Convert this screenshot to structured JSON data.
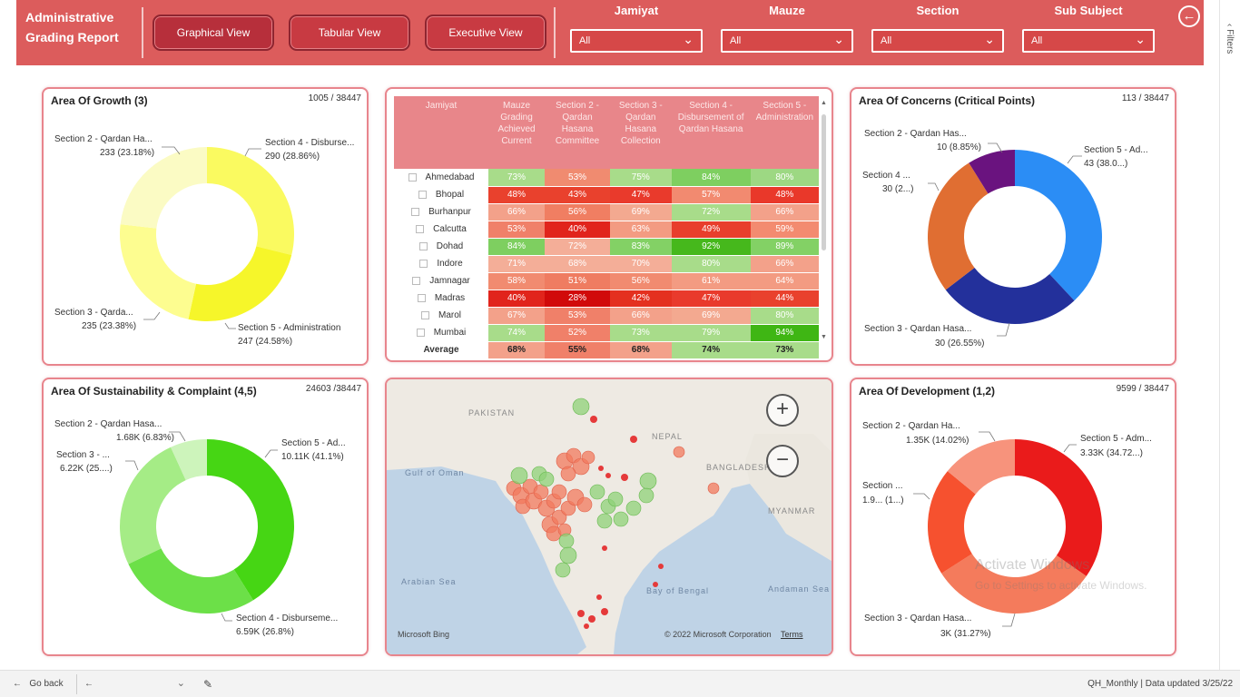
{
  "header": {
    "title_line1": "Administrative",
    "title_line2": "Grading Report",
    "buttons": [
      "Graphical View",
      "Tabular View",
      "Executive View"
    ],
    "slicers": [
      {
        "label": "Jamiyat",
        "value": "All"
      },
      {
        "label": "Mauze",
        "value": "All"
      },
      {
        "label": "Section",
        "value": "All"
      },
      {
        "label": "Sub Subject",
        "value": "All"
      }
    ],
    "back_icon": "back-arrow-icon"
  },
  "filters_pane": {
    "label": "Filters",
    "icon": "chevron-left-icon"
  },
  "panels": {
    "growth": {
      "title": "Area Of Growth (3)",
      "count": "1005 / 38447",
      "labels": [
        {
          "name": "Section 2 - Qardan Ha...",
          "value": "233 (23.18%)"
        },
        {
          "name": "Section 4 - Disburse...",
          "value": "290 (28.86%)"
        },
        {
          "name": "Section 3 - Qarda...",
          "value": "235 (23.38%)"
        },
        {
          "name": "Section 5 - Administration",
          "value": "247 (24.58%)"
        }
      ]
    },
    "concerns": {
      "title": "Area Of Concerns (Critical Points)",
      "count": "113 / 38447",
      "labels": [
        {
          "name": "Section 2 - Qardan Has...",
          "value": "10 (8.85%)"
        },
        {
          "name": "Section 5 - Ad...",
          "value": "43 (38.0...)"
        },
        {
          "name": "Section 4 ...",
          "value": "30 (2...)"
        },
        {
          "name": "Section 3 - Qardan Hasa...",
          "value": "30 (26.55%)"
        }
      ]
    },
    "sustainability": {
      "title": "Area Of Sustainability & Complaint (4,5)",
      "count": "24603 /38447",
      "labels": [
        {
          "name": "Section 2 - Qardan Hasa...",
          "value": "1.68K (6.83%)"
        },
        {
          "name": "Section 3 - ...",
          "value": "6.22K (25....)"
        },
        {
          "name": "Section 5 - Ad...",
          "value": "10.11K (41.1%)"
        },
        {
          "name": "Section 4 - Disburseme...",
          "value": "6.59K (26.8%)"
        }
      ]
    },
    "development": {
      "title": "Area Of Development (1,2)",
      "count": "9599 / 38447",
      "labels": [
        {
          "name": "Section 2 - Qardan Ha...",
          "value": "1.35K (14.02%)"
        },
        {
          "name": "Section 5 - Adm...",
          "value": "3.33K (34.72...)"
        },
        {
          "name": "Section ...",
          "value": "1.9... (1...)"
        },
        {
          "name": "Section 3 - Qardan Hasa...",
          "value": "3K (31.27%)"
        }
      ]
    }
  },
  "chart_data": [
    {
      "type": "pie",
      "title": "Area Of Growth (3)",
      "categories": [
        "Section 4 - Disbursement of Qardan Hasana",
        "Section 5 - Administration",
        "Section 3 - Qardan Hasana Collection",
        "Section 2 - Qardan Hasana Committee"
      ],
      "values": [
        290,
        247,
        235,
        233
      ],
      "colors": [
        "#fafa60",
        "#f6f62a",
        "#fdfd90",
        "#fbfbc4"
      ]
    },
    {
      "type": "pie",
      "title": "Area Of Concerns (Critical Points)",
      "categories": [
        "Section 5 - Administration",
        "Section 3 - Qardan Hasana Collection",
        "Section 4",
        "Section 2 - Qardan Hasana Committee"
      ],
      "values": [
        43,
        30,
        30,
        10
      ],
      "colors": [
        "#2b8df5",
        "#23309b",
        "#e06e32",
        "#6a137f"
      ]
    },
    {
      "type": "pie",
      "title": "Area Of Sustainability & Complaint (4,5)",
      "categories": [
        "Section 5 - Administration",
        "Section 4 - Disbursement",
        "Section 3",
        "Section 2 - Qardan Hasana"
      ],
      "values": [
        10110,
        6590,
        6220,
        1680
      ],
      "colors": [
        "#46d614",
        "#6ce048",
        "#a5ec86",
        "#cdf4bb"
      ]
    },
    {
      "type": "pie",
      "title": "Area Of Development (1,2)",
      "categories": [
        "Section 5 - Administration",
        "Section 3 - Qardan Hasana Collection",
        "Section 4",
        "Section 2 - Qardan Hasana"
      ],
      "values": [
        3330,
        3000,
        1920,
        1350
      ],
      "colors": [
        "#ea1b1b",
        "#f47b5c",
        "#f6512f",
        "#f7937c"
      ]
    }
  ],
  "matrix": {
    "columns": [
      "Jamiyat",
      "Mauze Grading Achieved Current",
      "Section 2 - Qardan Hasana Committee",
      "Section 3 - Qardan Hasana Collection",
      "Section 4 - Disbursement of Qardan Hasana",
      "Section 5 - Administration"
    ],
    "rows": [
      {
        "city": "Ahmedabad",
        "values": [
          "73%",
          "53%",
          "75%",
          "84%",
          "80%"
        ],
        "colors": [
          "#a8dc8a",
          "#f08b70",
          "#a8dc8a",
          "#7ecf60",
          "#9dd883"
        ]
      },
      {
        "city": "Bhopal",
        "values": [
          "48%",
          "43%",
          "47%",
          "57%",
          "48%"
        ],
        "colors": [
          "#e9412d",
          "#e9412d",
          "#e93a2c",
          "#f28a70",
          "#e9382a"
        ]
      },
      {
        "city": "Burhanpur",
        "values": [
          "66%",
          "56%",
          "69%",
          "72%",
          "66%"
        ],
        "colors": [
          "#f3a18a",
          "#f07e62",
          "#f3a990",
          "#a8dc8a",
          "#f3a18a"
        ]
      },
      {
        "city": "Calcutta",
        "values": [
          "53%",
          "40%",
          "63%",
          "49%",
          "59%"
        ],
        "colors": [
          "#f08069",
          "#e1241c",
          "#f39b82",
          "#e83e2c",
          "#f38b70"
        ]
      },
      {
        "city": "Dohad",
        "values": [
          "84%",
          "72%",
          "83%",
          "92%",
          "89%"
        ],
        "colors": [
          "#7ecf60",
          "#f4ae98",
          "#83d165",
          "#46b81c",
          "#83d165"
        ]
      },
      {
        "city": "Indore",
        "values": [
          "71%",
          "68%",
          "70%",
          "80%",
          "66%"
        ],
        "colors": [
          "#f4ae98",
          "#f4ae98",
          "#f4ae98",
          "#a8dc8a",
          "#f3a18a"
        ]
      },
      {
        "city": "Jamnagar",
        "values": [
          "58%",
          "51%",
          "56%",
          "61%",
          "64%"
        ],
        "colors": [
          "#f18b70",
          "#ef7c61",
          "#f18b70",
          "#f39b82",
          "#f39b82"
        ]
      },
      {
        "city": "Madras",
        "values": [
          "40%",
          "28%",
          "42%",
          "47%",
          "44%"
        ],
        "colors": [
          "#e1241c",
          "#d10a0a",
          "#e4301f",
          "#e93a2c",
          "#e9412d"
        ]
      },
      {
        "city": "Marol",
        "values": [
          "67%",
          "53%",
          "66%",
          "69%",
          "80%"
        ],
        "colors": [
          "#f3a18a",
          "#f08069",
          "#f3a18a",
          "#f3a990",
          "#a8dc8a"
        ]
      },
      {
        "city": "Mumbai",
        "values": [
          "74%",
          "52%",
          "73%",
          "79%",
          "94%"
        ],
        "colors": [
          "#a8dc8a",
          "#f08069",
          "#a8dc8a",
          "#a8dc8a",
          "#3fb614"
        ]
      }
    ],
    "average": {
      "label": "Average",
      "values": [
        "68%",
        "55%",
        "68%",
        "74%",
        "73%"
      ],
      "colors": [
        "#f3a18a",
        "#f08069",
        "#f3a18a",
        "#a8dc8a",
        "#a8dc8a"
      ]
    }
  },
  "map": {
    "labels": {
      "pakistan": "PAKISTAN",
      "nepal": "NEPAL",
      "bangladesh": "BANGLADESH",
      "myanmar": "MYANMAR",
      "arabian_sea": "Arabian Sea",
      "bay_of_bengal": "Bay of Bengal",
      "gulf_of_oman": "Gulf of Oman",
      "andaman_sea": "Andaman Sea"
    },
    "copyright": "© 2022 Microsoft Corporation",
    "terms": "Terms",
    "provider": "Microsoft Bing",
    "zoom_in_icon": "plus-icon",
    "zoom_out_icon": "minus-icon"
  },
  "watermark": {
    "line1": "Activate Windows",
    "line2": "Go to Settings to activate Windows."
  },
  "footer": {
    "go_back": "Go back",
    "page_select": "",
    "status": "QH_Monthly  |  Data updated 3/25/22"
  }
}
